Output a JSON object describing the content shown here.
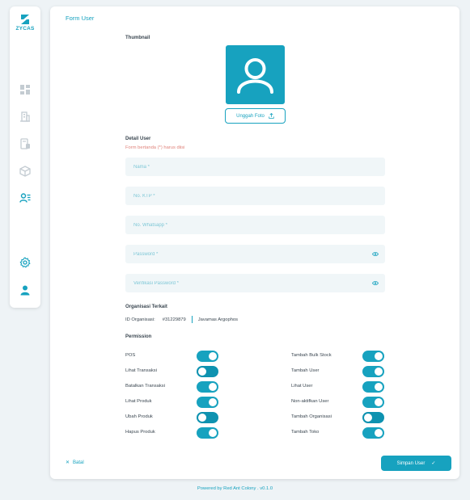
{
  "brand": {
    "name": "ZYCAS",
    "color": "#17a2bf"
  },
  "sidebar": {
    "items": [
      {
        "icon": "dashboard-icon",
        "active": false
      },
      {
        "icon": "building-icon",
        "active": false
      },
      {
        "icon": "report-icon",
        "active": false
      },
      {
        "icon": "box-icon",
        "active": false
      },
      {
        "icon": "user-list-icon",
        "active": true
      }
    ],
    "bottom": [
      {
        "icon": "gear-icon"
      },
      {
        "icon": "user-icon"
      }
    ]
  },
  "form": {
    "title": "Form User",
    "thumbnail_label": "Thumbnail",
    "thumbnail_icon": "user-avatar-icon",
    "upload_label": "Unggah Foto",
    "detail_label": "Detail User",
    "required_note": "Form bertanda (*) harus diisi",
    "fields": {
      "name": {
        "placeholder": "Nama *",
        "value": ""
      },
      "ktp": {
        "placeholder": "No. KTP *",
        "value": ""
      },
      "whatsapp": {
        "placeholder": "No. Whatsapp *",
        "value": ""
      },
      "password": {
        "placeholder": "Password *",
        "value": ""
      },
      "password_confirm": {
        "placeholder": "Verifikasi Password *",
        "value": ""
      }
    },
    "org": {
      "label": "Organisasi Terkait",
      "id_label": "ID Organisasi:",
      "id_value": "#31229879",
      "name": "Javamas Argophos"
    },
    "permission_label": "Permission",
    "permissions_left": [
      {
        "label": "POS",
        "enabled": true
      },
      {
        "label": "Lihat Transaksi",
        "enabled": false
      },
      {
        "label": "Batalkan Transaksi",
        "enabled": true
      },
      {
        "label": "Lihat Produk",
        "enabled": true
      },
      {
        "label": "Ubah Produk",
        "enabled": false
      },
      {
        "label": "Hapus Produk",
        "enabled": true
      }
    ],
    "permissions_right": [
      {
        "label": "Tambah Bulk Stock",
        "enabled": true
      },
      {
        "label": "Tambah User",
        "enabled": true
      },
      {
        "label": "Lihat User",
        "enabled": true
      },
      {
        "label": "Non-aktifkan User",
        "enabled": true
      },
      {
        "label": "Tambah Organisasi",
        "enabled": false
      },
      {
        "label": "Tambah Toko",
        "enabled": true
      }
    ],
    "cancel_label": "Batal",
    "save_label": "Simpan User"
  },
  "footer": "Powered by Red Ant Colony . v0.1.0"
}
